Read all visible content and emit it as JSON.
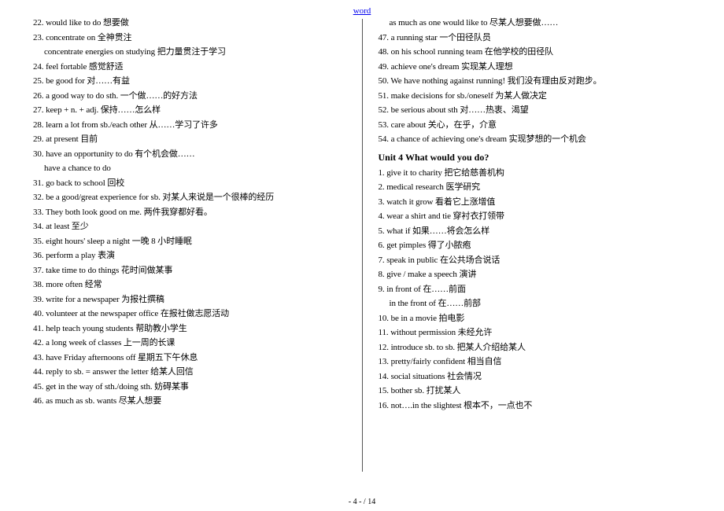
{
  "header": {
    "link": "word"
  },
  "footer": {
    "page": "- 4 - / 14"
  },
  "left": {
    "e22": "22. would like to do       想要做",
    "e23": "23. concentrate on         全神贯注",
    "e23b": "concentrate energies on studying  把力量贯注于学习",
    "e24": "24. feel fortable       感觉舒适",
    "e25": "25. be good for            对……有益",
    "e26": "26. a good way to do sth.       一个做……的好方法",
    "e27": "27. keep + n. + adj.            保持……怎么样",
    "e28": "28. learn a lot from sb./each other   从……学习了许多",
    "e29": "29. at present           目前",
    "e30": "30. have an opportunity to do        有个机会做……",
    "e30b": "have a chance to do",
    "e31": "31. go back to school             回校",
    "e32": "32. be a good/great experience for sb.   对某人来说是一个很棒的经历",
    "e33": "33. They    both look good on me.    两件我穿都好看。",
    "e34": "34. at least           至少",
    "e35": "35. eight hours' sleep a night       一晚 8 小时睡眠",
    "e36": "36. perform a play            表演",
    "e37": "37. take time to do things     花时间做某事",
    "e38": "38. more often              经常",
    "e39": "39. write for a newspaper    为报社撰稿",
    "e40": "40. volunteer at the newspaper office   在报社做志愿活动",
    "e41": "41. help teach young students          帮助教小学生",
    "e42": "42. a long week of classes             上一周的长课",
    "e43": "43. have Friday afternoons off         星期五下午休息",
    "e44": "44. reply to sb. = answer the letter      给某人回信",
    "e45": "45. get in the way of sth./doing sth.     妨碍某事",
    "e46": "46. as much as sb. wants                尽某人想要"
  },
  "right": {
    "e46b": "as much as one would like to       尽某人想要做……",
    "e47": "47. a running star                      一个田径队员",
    "e48": "48. on his school running team        在他学校的田径队",
    "e49": "49. achieve one's dream             实现某人理想",
    "e50": "50. We have nothing against running!  我们没有理由反对跑步。",
    "e51": "51. make decisions for sb./oneself    为某人做决定",
    "e52": "52. be serious about sth          对……热衷、渴望",
    "e53": "53. care about          关心，在乎，介意",
    "e54": "54. a chance of achieving one's dream 实现梦想的一个机会",
    "unit4": "Unit 4 What would you do?",
    "u1": "1. give it to charity 把它给慈善机构",
    "u2": "2. medical research   医学研究",
    "u3": "3. watch it grow  看着它上涨增值",
    "u4": "4. wear a shirt and tie 穿衬衣打领带",
    "u5": "5. what if 如果……将会怎么样",
    "u6": "6. get pimples    得了小脓疱",
    "u7": "7. speak in public 在公共场合说话",
    "u8": "8. give / make a speech   演讲",
    "u9": "9. in front of  在……前面",
    "u9b": "in the front of 在……前部",
    "u10": "10. be in a movie    拍电影",
    "u11": "11. without permission    未经允许",
    "u12": "12. introduce sb. to sb.  把某人介绍给某人",
    "u13": "13. pretty/fairly confident    相当自信",
    "u14": "14. social situations   社会情况",
    "u15": "15. bother sb.   打扰某人",
    "u16": "16. not….in the slightest  根本不，一点也不"
  }
}
